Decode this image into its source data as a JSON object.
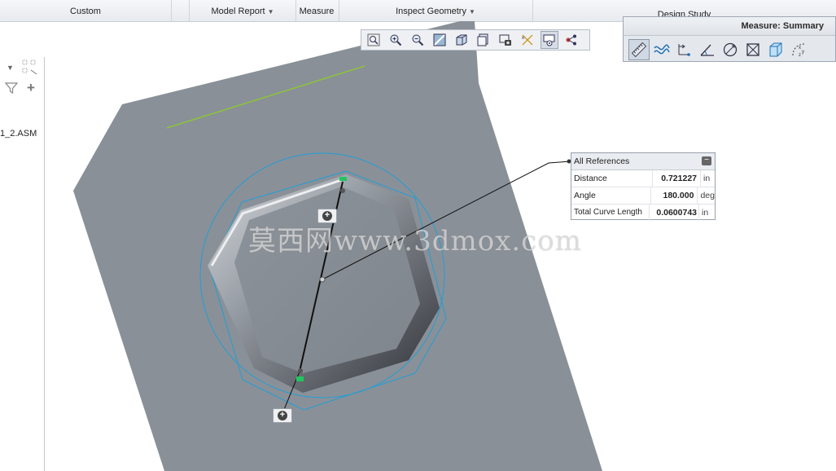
{
  "ribbon": {
    "groups": [
      {
        "label": "Custom",
        "has_dropdown": false
      },
      {
        "label": "Model Report",
        "has_dropdown": true
      },
      {
        "label": "Measure",
        "has_dropdown": false
      },
      {
        "label": "Inspect Geometry",
        "has_dropdown": true
      },
      {
        "label": "Design Study",
        "has_dropdown": false
      }
    ]
  },
  "model_tree": {
    "item_label": "1_2.ASM",
    "icons": [
      "dropdown-arrow-icon",
      "tree-settings-icon",
      "filter-icon",
      "add-icon"
    ]
  },
  "view_toolbar": {
    "icons": [
      "refit-icon",
      "zoom-in-icon",
      "zoom-out-icon",
      "repaint-icon",
      "display-style-icon",
      "saved-views-icon",
      "view-manager-icon",
      "datum-display-icon",
      "spin-center-icon",
      "annotation-display-icon"
    ],
    "selected_index": 8
  },
  "measure": {
    "title": "Measure: Summary",
    "tools": [
      "length-icon",
      "curve-length-icon",
      "distance-icon",
      "angle-icon",
      "diameter-icon",
      "area-icon",
      "volume-icon",
      "transform-icon"
    ],
    "selected_tool": 0
  },
  "results": {
    "header": "All References",
    "rows": [
      {
        "label": "Distance",
        "value": "0.721227",
        "unit": "in"
      },
      {
        "label": "Angle",
        "value": "180.000",
        "unit": "deg"
      },
      {
        "label": "Total Curve Length",
        "value": "0.0600743",
        "unit": "in"
      }
    ]
  },
  "watermark": "莫西网www.3dmox.com",
  "colors": {
    "plate": "#8a9098",
    "boss_face": "#868c94",
    "highlight_circle": "#1e9fd6",
    "datum_line": "#8ccc2a",
    "pick_marker": "#22c55e"
  }
}
